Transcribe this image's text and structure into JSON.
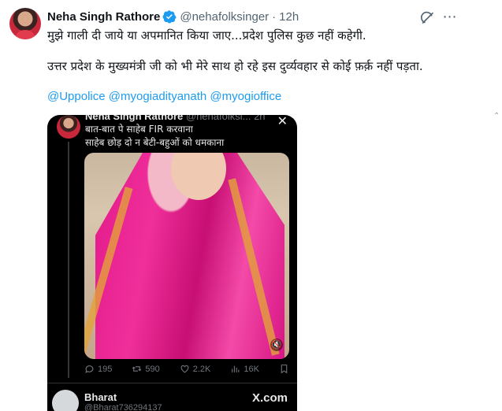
{
  "author": {
    "name": "Neha Singh Rathore",
    "handle": "@nehafolksinger",
    "separator": "·",
    "time": "12h"
  },
  "tweet": {
    "line1": "मुझे गाली दी जाये या अपमानित किया जाए...प्रदेश पुलिस कुछ नहीं कहेगी.",
    "line2": "उत्तर प्रदेश के मुख्यमंत्री जी को भी मेरे साथ हो रहे इस दुर्व्यवहार से कोई फ़र्क़ नहीं पड़ता.",
    "mentions": [
      "@Uppolice",
      "@myogiadityanath",
      "@myogioffice"
    ]
  },
  "media": {
    "inner_name": "Neha Singh Rathore",
    "inner_handle": "@nehafolksi...",
    "inner_time": "2h",
    "caption1": "बात-बात पे साहेब FIR करवाना",
    "caption2": "साहेब छोड़ दो न बेटी-बहुओं को धमकाना",
    "stats": {
      "replies": "195",
      "retweets": "590",
      "likes": "2.2K",
      "views": "16K"
    },
    "footer_name": "Bharat",
    "footer_handle": "@Bharat736294137",
    "footer_site": "X.com"
  },
  "colors": {
    "accent": "#1d9bf0",
    "text": "#0f1419",
    "muted": "#536471"
  },
  "icons": [
    "verified-badge-icon",
    "grok-icon",
    "more-icon",
    "close-icon",
    "reply-icon",
    "retweet-icon",
    "like-icon",
    "views-icon",
    "bookmark-icon",
    "volume-icon"
  ]
}
